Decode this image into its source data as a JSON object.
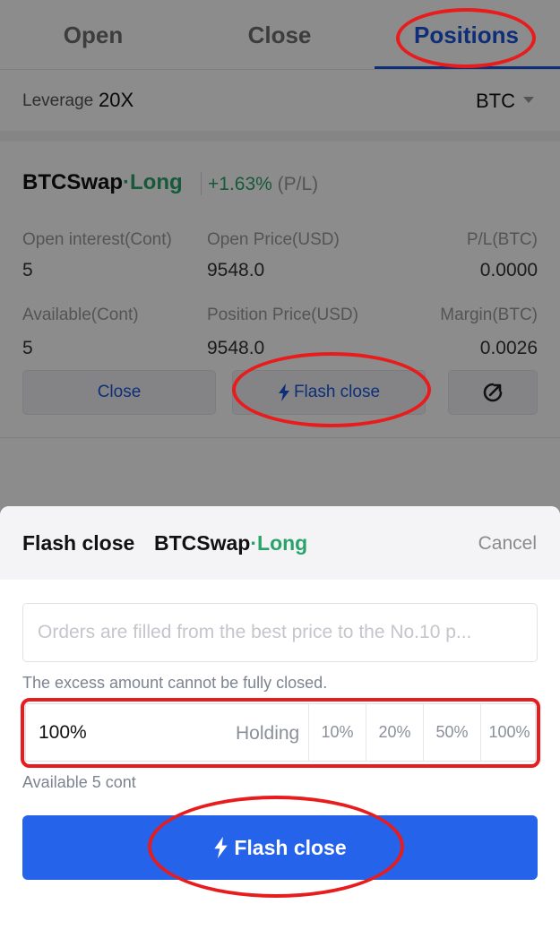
{
  "tabs": [
    {
      "label": "Open"
    },
    {
      "label": "Close"
    },
    {
      "label": "Positions"
    }
  ],
  "leverage": {
    "label": "Leverage",
    "value": "20X"
  },
  "coin_selector": {
    "value": "BTC"
  },
  "position": {
    "instrument": "BTCSwap",
    "separator": "·",
    "direction": "Long",
    "pl_value": "+1.63%",
    "pl_label": "(P/L)",
    "fields": {
      "open_interest": {
        "label": "Open interest(Cont)",
        "value": "5"
      },
      "open_price": {
        "label": "Open Price(USD)",
        "value": "9548.0"
      },
      "pl_btc": {
        "label": "P/L(BTC)",
        "value": "0.0000"
      },
      "available": {
        "label": "Available(Cont)",
        "value": "5"
      },
      "position_price": {
        "label": "Position Price(USD)",
        "value": "9548.0"
      },
      "margin": {
        "label": "Margin(BTC)",
        "value": "0.0026"
      }
    },
    "actions": {
      "close_label": "Close",
      "flash_close_label": "Flash close"
    }
  },
  "sheet": {
    "title": "Flash close",
    "instrument": "BTCSwap",
    "separator": "·",
    "direction": "Long",
    "cancel_label": "Cancel",
    "notice": "Orders are filled from the best price to the No.10 p...",
    "hint": "The excess amount cannot be fully closed.",
    "amount_value": "100%",
    "holding_label": "Holding",
    "percent_options": [
      "10%",
      "20%",
      "50%",
      "100%"
    ],
    "available_text": "Available 5 cont",
    "submit_label": "Flash close"
  },
  "colors": {
    "accent": "#1a56db",
    "button": "#2563eb",
    "long": "#2aa36b",
    "annotation": "#e81c1c"
  },
  "icons": {
    "flash": "lightning-bolt-icon",
    "share": "share-icon",
    "caret": "caret-down-icon"
  }
}
